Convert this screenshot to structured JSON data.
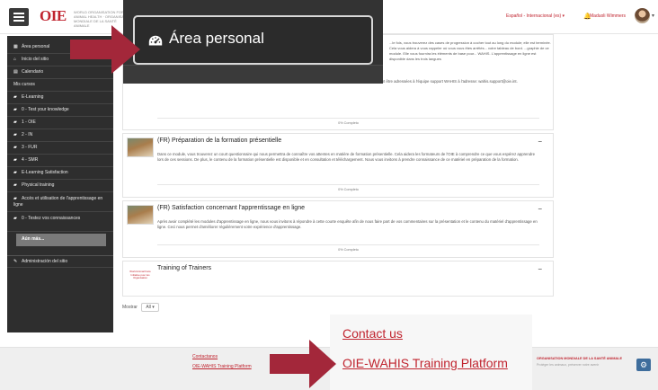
{
  "header": {
    "logo_mark": "OIE",
    "logo_text": "WORLD ORGANISATION FOR ANIMAL HEALTH · ORGANISATION MONDIALE DE LA SANTÉ ANIMALE",
    "language": "Español - Internacional (es) ▾",
    "username": "Maduoli Wimmers",
    "user_caret": "▾"
  },
  "callout_area": {
    "label": "Área personal",
    "icon": "dashboard-icon"
  },
  "sidebar": {
    "items": [
      {
        "icon": "▦",
        "label": "Área personal"
      },
      {
        "icon": "⌂",
        "label": "Inicio del sitio"
      },
      {
        "icon": "▤",
        "label": "Calendario"
      },
      {
        "icon": "",
        "label": "Mis cursos"
      },
      {
        "icon": "▰",
        "label": "E-Learning"
      },
      {
        "icon": "▰",
        "label": "0 - Test your knowledge"
      },
      {
        "icon": "▰",
        "label": "1 - OIE"
      },
      {
        "icon": "▰",
        "label": "2 - IN"
      },
      {
        "icon": "▰",
        "label": "3 - FUR"
      },
      {
        "icon": "▰",
        "label": "4 - SMR"
      },
      {
        "icon": "▰",
        "label": "E-Learning Satisfaction"
      },
      {
        "icon": "▰",
        "label": "Physical training"
      },
      {
        "icon": "▰",
        "label": "Accès et utilisation de l'apprentissage en ligne"
      },
      {
        "icon": "▰",
        "label": "0 - Testez vos connaissances"
      }
    ],
    "more_label": "Aún más...",
    "admin": {
      "icon": "✎",
      "label": "Administración del sitio"
    }
  },
  "sections": [
    {
      "title": "",
      "body": "officielles de l'OIE (anglais, français et espagnol). Les demandes d'inscription dans une autre langue, ou toute autre question, doivent être adressées à l'équipe support WAHIS à l'adresse: wahis.support@oie.int.",
      "progress": "0% Completo"
    },
    {
      "title": "(FR) Préparation de la formation présentielle",
      "body": "Dans ce module, vous trouverez un court questionnaire qui nous permettra de connaître vos attentes en matière de formation présentielle. Cela aidera les formateurs de l'OIE à comprendre ce que vous espérez apprendre lors de ces sessions. De plus, le contenu de la formation présentielle est disponible et en consultation et téléchargement. Nous vous invitons à prendre connaissance de ce matériel en préparation de la formation.",
      "progress": "0% Completo"
    },
    {
      "title": "(FR) Satisfaction concernant l'apprentissage en ligne",
      "body": "Après avoir complété les modules d'apprentissage en ligne, nous vous invitons à répondre à cette courte enquête afin de nous faire part de vos commentaires sur la présentation et le contenu du matériel d'apprentissage en ligne. Ceci nous permet d'améliorer régulièrement votre expérience d'apprentissage.",
      "progress": "0% Completo"
    },
    {
      "title": "Training of Trainers",
      "thumb_text": "World Animal Fans Initiative pour les Organisation",
      "body": "",
      "progress": ""
    }
  ],
  "top_body_fragment": "...le fois, vous trouverez des cases de progression à cocher tout au long du module; elle est terminée. Cela vous aidera à vous rappeler où vous vous êtes arrêtés... votre tableau de bord. ...graphie de ce module. Elle vous fournira les éléments de base pour... WAHIS. L'apprentissage en ligne est disponible dans les trois langues",
  "show": {
    "label": "Mostrar",
    "value": "All ▾"
  },
  "footer": {
    "contact": "Contactanos",
    "platform": "OIE-WAHIS Training Platform",
    "org": "ORGANISATION MONDIALE DE LA SANTÉ ANIMALE",
    "org_sub": "Protéger les animaux, préserver notre avenir",
    "button_icon": "settings-icon"
  },
  "callout_links": {
    "contact": "Contact us",
    "platform": "OIE-WAHIS Training Platform"
  },
  "colors": {
    "accent": "#c0242f",
    "sidebar": "#2e2e2e",
    "arrow": "#a3273a"
  }
}
